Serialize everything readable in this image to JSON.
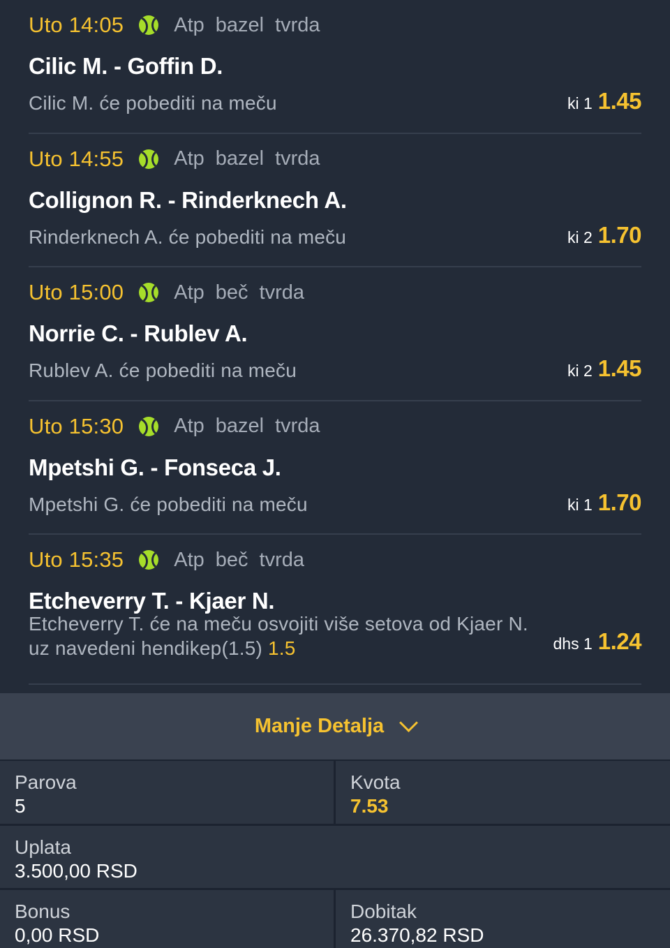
{
  "matches": [
    {
      "time": "Uto 14:05",
      "tour": [
        "Atp",
        "bazel",
        "tvrda"
      ],
      "teams": "Cilic M. - Goffin D.",
      "pick": "Cilic M. će pobediti na meču",
      "odds_type": "ki 1",
      "odds": "1.45"
    },
    {
      "time": "Uto 14:55",
      "tour": [
        "Atp",
        "bazel",
        "tvrda"
      ],
      "teams": "Collignon R. - Rinderknech A.",
      "pick": "Rinderknech A. će pobediti na meču",
      "odds_type": "ki 2",
      "odds": "1.70"
    },
    {
      "time": "Uto 15:00",
      "tour": [
        "Atp",
        "beč",
        "tvrda"
      ],
      "teams": "Norrie C. - Rublev A.",
      "pick": "Rublev A. će pobediti na meču",
      "odds_type": "ki 2",
      "odds": "1.45"
    },
    {
      "time": "Uto 15:30",
      "tour": [
        "Atp",
        "bazel",
        "tvrda"
      ],
      "teams": "Mpetshi G. - Fonseca J.",
      "pick": "Mpetshi G. će pobediti na meču",
      "odds_type": "ki 1",
      "odds": "1.70"
    },
    {
      "time": "Uto 15:35",
      "tour": [
        "Atp",
        "beč",
        "tvrda"
      ],
      "teams": "Etcheverry T. - Kjaer N.",
      "pick": "Etcheverry T. će na meču osvojiti više setova od Kjaer N. uz navedeni hendikep(1.5)",
      "handicap": "1.5",
      "odds_type": "dhs 1",
      "odds": "1.24"
    }
  ],
  "details": {
    "label": "Manje Detalja",
    "icon": "chevron-down-icon"
  },
  "summary": {
    "parova_label": "Parova",
    "parova_value": "5",
    "kvota_label": "Kvota",
    "kvota_value": "7.53",
    "uplata_label": "Uplata",
    "uplata_value": "3.500,00 RSD",
    "bonus_label": "Bonus",
    "bonus_value": "0,00 RSD",
    "dobitak_label": "Dobitak",
    "dobitak_value": "26.370,82 RSD"
  },
  "colors": {
    "accent": "#f6c230",
    "background": "#232b38",
    "tennis_ball": "#a6dd2a"
  }
}
